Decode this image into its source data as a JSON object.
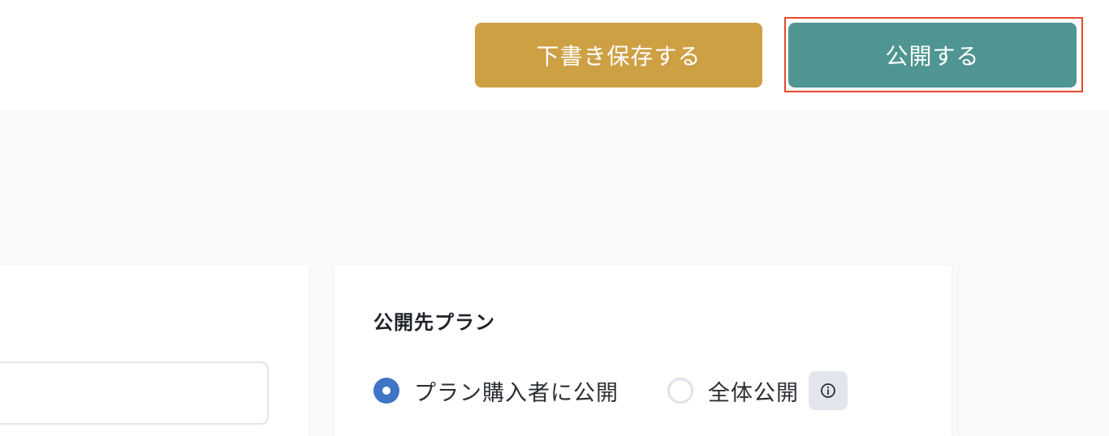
{
  "header": {
    "draft_button_label": "下書き保存する",
    "publish_button_label": "公開する"
  },
  "visibility": {
    "section_title": "公開先プラン",
    "options": [
      {
        "label": "プラン購入者に公開",
        "selected": true
      },
      {
        "label": "全体公開",
        "selected": false
      }
    ],
    "info_icon": "info-circle-icon"
  },
  "colors": {
    "draft_button": "#cda044",
    "publish_button": "#4f9591",
    "highlight_border": "#e5492e",
    "radio_selected": "#3f74c6"
  }
}
